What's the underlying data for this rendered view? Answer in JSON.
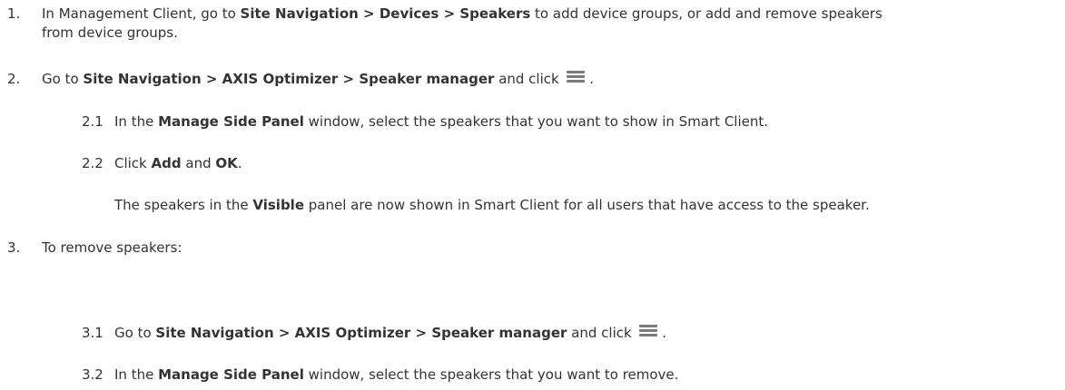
{
  "steps": [
    {
      "num": "1.",
      "line1": {
        "t1": "In Management Client, go to ",
        "b1": "Site Navigation > Devices > Speakers",
        "t2": " to add device groups, or add and remove speakers"
      },
      "line2": "from device groups."
    },
    {
      "num": "2.",
      "t1": "Go to ",
      "b1": "Site Navigation > AXIS Optimizer > Speaker manager",
      "t2": " and click",
      "t3": ".",
      "icon": "list-icon",
      "substeps": [
        {
          "num": "2.1",
          "t1": "In the ",
          "b1": "Manage Side Panel",
          "t2": " window, select the speakers that you want to show in Smart Client."
        },
        {
          "num": "2.2",
          "t1": "Click ",
          "b1": "Add",
          "t2": " and ",
          "b2": "OK",
          "t3": "."
        }
      ],
      "result": {
        "t1": "The speakers in the ",
        "b1": "Visible",
        "t2": " panel are now shown in Smart Client for all users that have access to the speaker."
      }
    },
    {
      "num": "3.",
      "text": "To remove speakers:",
      "substeps": [
        {
          "num": "3.1",
          "t1": "Go to ",
          "b1": "Site Navigation > AXIS Optimizer > Speaker manager",
          "t2": " and click",
          "t3": ".",
          "icon": "list-icon"
        },
        {
          "num": "3.2",
          "t1": "In the ",
          "b1": "Manage Side Panel",
          "t2": " window, select the speakers that you want to remove."
        }
      ]
    }
  ]
}
